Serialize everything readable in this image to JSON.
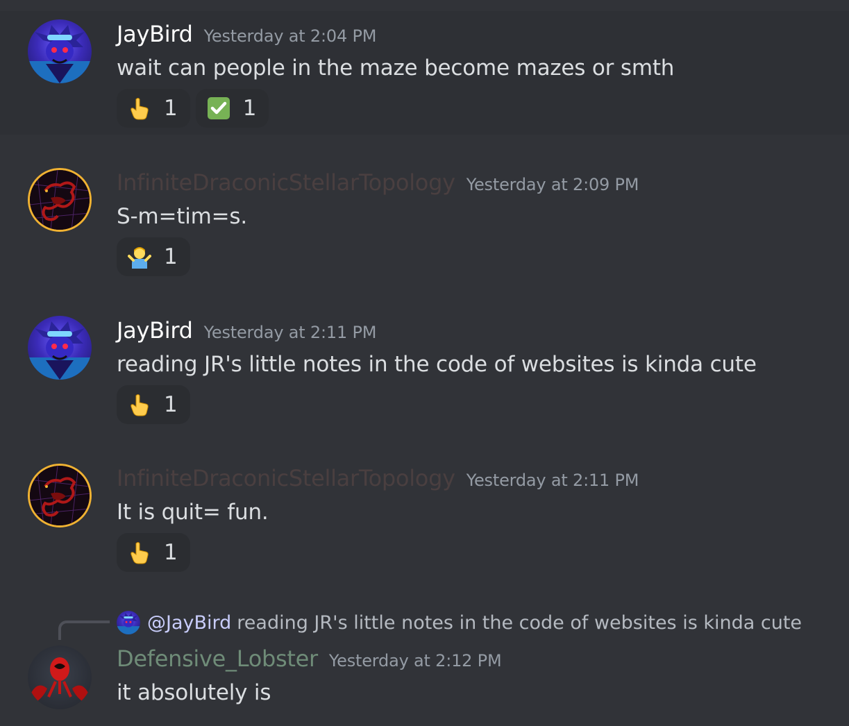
{
  "messages": [
    {
      "username": "JayBird",
      "username_color": "#ffffff",
      "timestamp": "Yesterday at 2:04 PM",
      "content": "wait can people in the maze become mazes or smth",
      "avatar": "sonic-character-avatar",
      "reactions": [
        {
          "emoji": "point-up-icon",
          "count": "1"
        },
        {
          "emoji": "white-check-mark-icon",
          "count": "1"
        }
      ]
    },
    {
      "username": "InfiniteDraconicStellarTopology",
      "username_color": "#4a3f40",
      "timestamp": "Yesterday at 2:09 PM",
      "content": "S-m=tim=s.",
      "avatar": "dragon-avatar",
      "reactions": [
        {
          "emoji": "shrug-icon",
          "count": "1"
        }
      ]
    },
    {
      "username": "JayBird",
      "username_color": "#ffffff",
      "timestamp": "Yesterday at 2:11 PM",
      "content": "reading JR's little notes in the code of websites is kinda cute",
      "avatar": "sonic-character-avatar",
      "reactions": [
        {
          "emoji": "point-up-icon",
          "count": "1"
        }
      ]
    },
    {
      "username": "InfiniteDraconicStellarTopology",
      "username_color": "#4a3f40",
      "timestamp": "Yesterday at 2:11 PM",
      "content": "It is quit= fun.",
      "avatar": "dragon-avatar",
      "reactions": [
        {
          "emoji": "point-up-icon",
          "count": "1"
        }
      ]
    },
    {
      "username": "Defensive_Lobster",
      "username_color": "#6f8c78",
      "timestamp": "Yesterday at 2:12 PM",
      "content": "it absolutely is",
      "avatar": "lobster-avatar",
      "reply": {
        "mention": "@JayBird",
        "text": "reading JR's little notes in the code of websites is kinda cute"
      },
      "reactions": []
    }
  ]
}
